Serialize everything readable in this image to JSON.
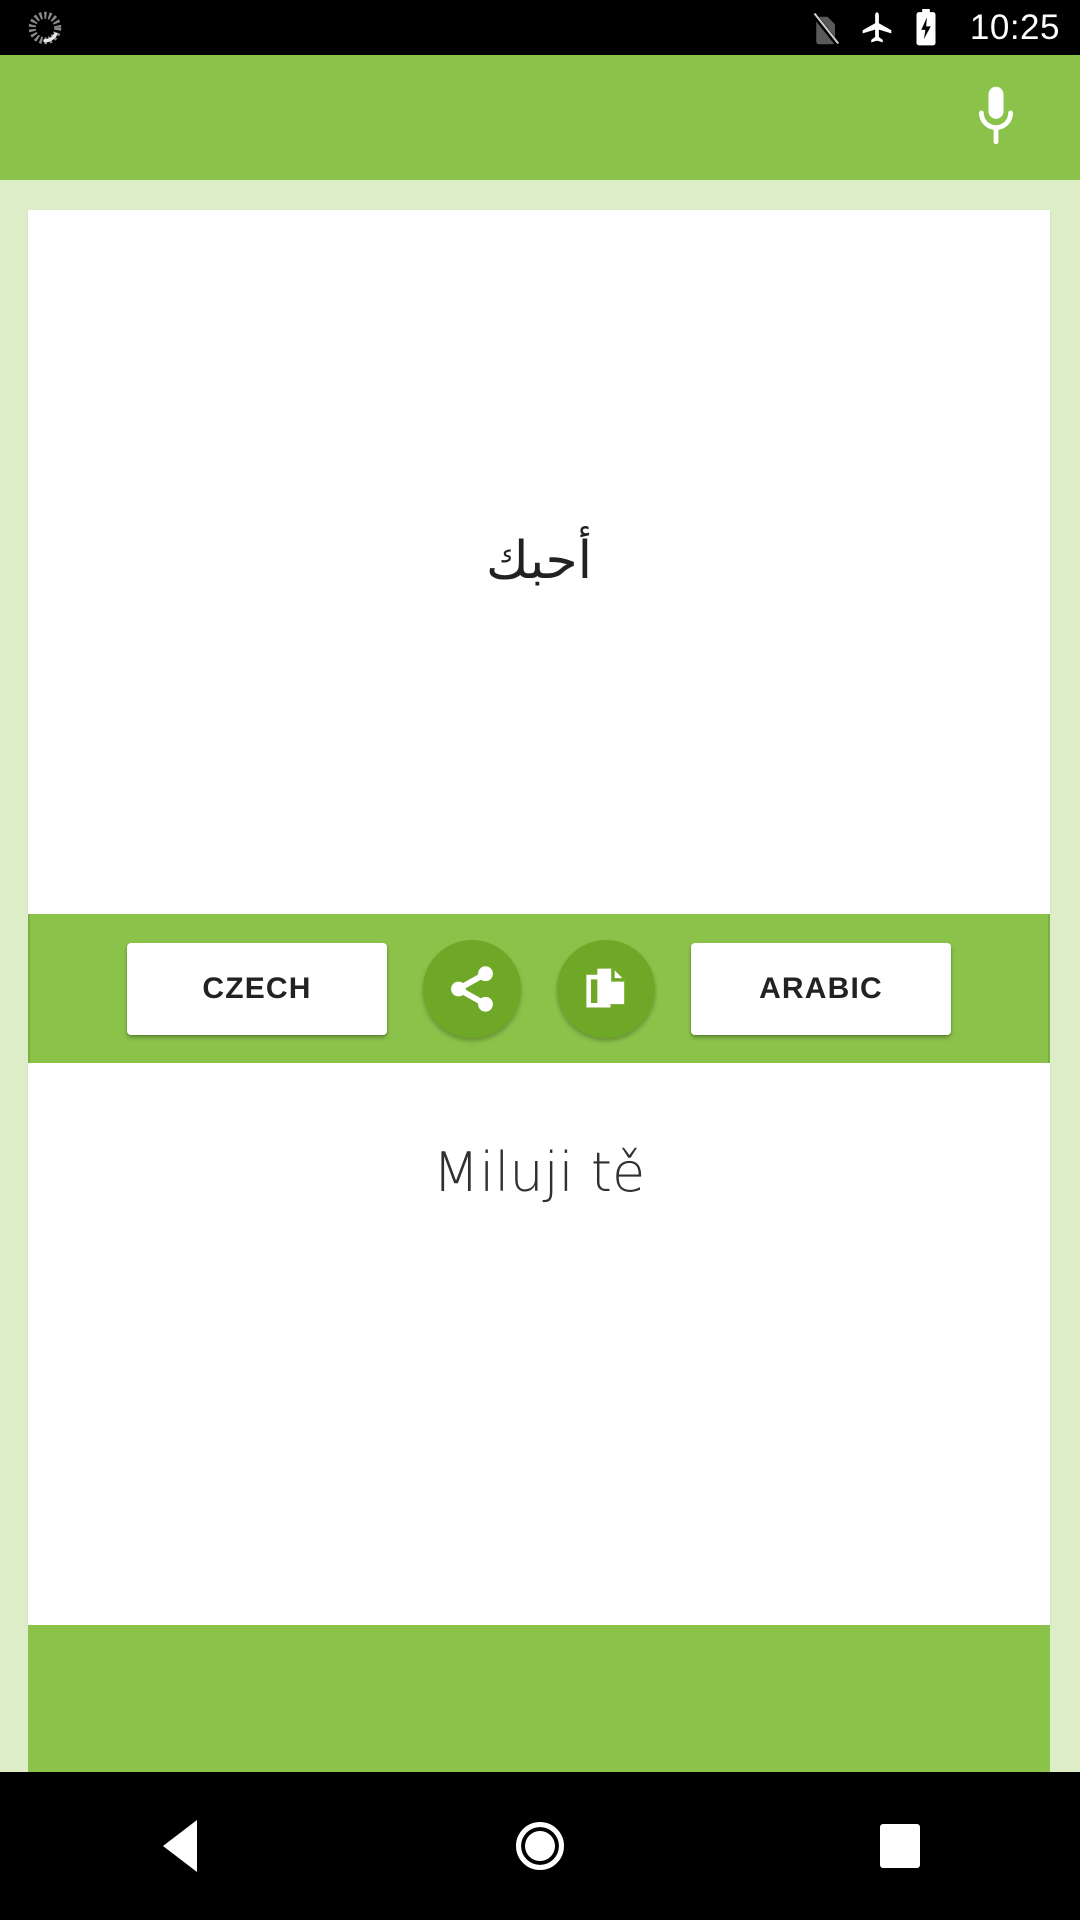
{
  "status_bar": {
    "time": "10:25",
    "left_icons": [
      "sync-spinner-icon"
    ],
    "right_icons": [
      "no-sim-icon",
      "airplane-mode-icon",
      "battery-charging-icon"
    ],
    "background_color": "#000000",
    "text_color": "#FFFFFF"
  },
  "app_bar": {
    "background_color": "#8BC34A",
    "mic_icon": "microphone-icon",
    "title": ""
  },
  "theme": {
    "accent_green": "#8BC34A",
    "dark_green": "#6FA726",
    "page_background": "#DCEDC8",
    "card_background": "#FFFFFF",
    "text_primary": "#212121"
  },
  "source_panel": {
    "text": "أحبك",
    "language": "ARABIC",
    "direction": "rtl"
  },
  "toolbar": {
    "source_language_label": "CZECH",
    "target_language_label": "ARABIC",
    "share_icon": "share-icon",
    "copy_icon": "copy-icon"
  },
  "target_panel": {
    "text": "Miluji tě",
    "language": "CZECH",
    "direction": "ltr"
  },
  "nav_bar": {
    "back_label": "Back",
    "home_label": "Home",
    "recents_label": "Recents",
    "background_color": "#000000"
  }
}
